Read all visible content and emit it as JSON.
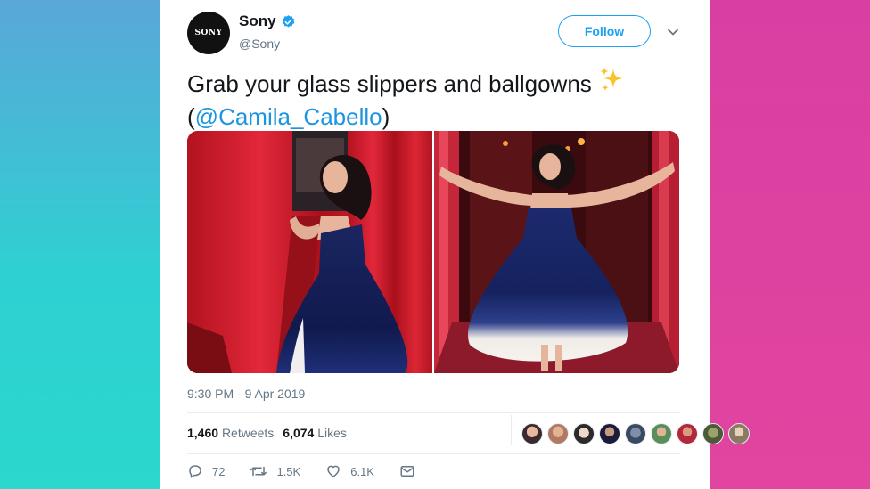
{
  "account": {
    "name": "Sony",
    "handle": "@Sony",
    "logo_text": "SONY",
    "verified": true
  },
  "header": {
    "follow_label": "Follow"
  },
  "tweet": {
    "text": "Grab your glass slippers and ballgowns",
    "open_paren": "(",
    "mention": "@Camila_Cabello",
    "close_paren": ")",
    "emoji": "sparkles",
    "timestamp": "9:30 PM - 9 Apr 2019"
  },
  "stats": {
    "retweets_count": "1,460",
    "retweets_label": "Retweets",
    "likes_count": "6,074",
    "likes_label": "Likes",
    "liker_avatar_count": 9
  },
  "actions": {
    "replies": "72",
    "retweets": "1.5K",
    "likes": "6.1K"
  },
  "colors": {
    "accent": "#1da1f2",
    "mention": "#1b95e0",
    "muted": "#657786",
    "text": "#14171a"
  }
}
